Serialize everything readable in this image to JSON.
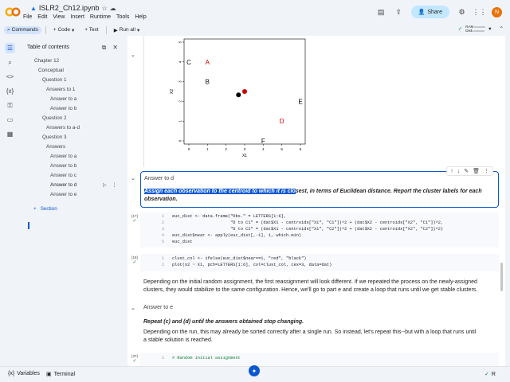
{
  "app": {
    "notebook_name": "ISLR2_Ch12.ipynb",
    "menus": [
      "File",
      "Edit",
      "View",
      "Insert",
      "Runtime",
      "Tools",
      "Help"
    ],
    "share_label": "Share",
    "avatar_initial": "N",
    "brand_color": "#e8710a"
  },
  "toolbar": {
    "commands": "Commands",
    "code": "+ Code",
    "text": "+ Text",
    "run_all": "Run all",
    "ram": "RAM",
    "disk": "Disk"
  },
  "toc": {
    "title": "Table of contents",
    "items": [
      {
        "label": "Chapter 12"
      },
      {
        "label": "Conceptual"
      },
      {
        "label": "Question 1"
      },
      {
        "label": "Answers to 1"
      },
      {
        "label": "Answer to a"
      },
      {
        "label": "Answer to b"
      },
      {
        "label": "Question 2"
      },
      {
        "label": "Answers to a-d"
      },
      {
        "label": "Question 3"
      },
      {
        "label": "Answers"
      },
      {
        "label": "Answer to a"
      },
      {
        "label": "Answer to b"
      },
      {
        "label": "Answer to c"
      },
      {
        "label": "Answer to d"
      },
      {
        "label": "Answer to e"
      }
    ],
    "section_label": "Section"
  },
  "plot": {
    "chart_data": {
      "type": "scatter",
      "xlabel": "X1",
      "ylabel": "X2",
      "xticks": [
        "0",
        "1",
        "2",
        "3",
        "4",
        "5",
        "6"
      ],
      "yticks": [
        "0",
        "1",
        "2",
        "3",
        "4",
        "5"
      ],
      "xlim": [
        0,
        6
      ],
      "ylim": [
        0,
        5
      ],
      "labels": [
        {
          "text": "C",
          "x": 0.0,
          "y": 4.0,
          "color": "#000000"
        },
        {
          "text": "A",
          "x": 1.0,
          "y": 4.0,
          "color": "#cc0000"
        },
        {
          "text": "B",
          "x": 1.0,
          "y": 3.0,
          "color": "#000000"
        },
        {
          "text": "E",
          "x": 6.0,
          "y": 2.0,
          "color": "#000000"
        },
        {
          "text": "D",
          "x": 5.0,
          "y": 1.0,
          "color": "#cc0000"
        },
        {
          "text": "F",
          "x": 4.0,
          "y": 0.0,
          "color": "#000000"
        }
      ],
      "centroids": [
        {
          "x": 3.0,
          "y": 2.5,
          "color": "#cc0000"
        },
        {
          "x": 2.67,
          "y": 2.33,
          "color": "#000000"
        }
      ]
    }
  },
  "answer_d": {
    "title": "Answer to d",
    "body_highlighted": "Assign each observation to the centroid to which it is clo",
    "body_rest": "sest, in terms of Euclidean distance. Report the cluster labels for each observation."
  },
  "cell1": {
    "exec": "[17]",
    "lines": [
      {
        "n": "1",
        "code": "euc_dist <- data.frame(\"Obs.\" = LETTERS[1:6],"
      },
      {
        "n": "2",
        "code": "                       \"D to C1\" = (dat$X1 - centroids[\"X1\", \"C1\"])^2 + (dat$X2 - centroids[\"X2\", \"C1\"])^2,"
      },
      {
        "n": "3",
        "code": "                       \"D to C2\" = (dat$X1 - centroids[\"X1\", \"C2\"])^2 + (dat$X2 - centroids[\"X2\", \"C2\"])^2)"
      },
      {
        "n": "4",
        "code": "euc_dist$near <- apply(euc_dist[,-1], 1, which.min)"
      },
      {
        "n": "5",
        "code": "euc_dist"
      }
    ]
  },
  "cell2": {
    "exec": "[18]",
    "lines": [
      {
        "n": "1",
        "code": "clust_col <- ifelse(euc_dist$near==1, \"red\", \"black\")"
      },
      {
        "n": "2",
        "code": "plot(X2 ~ X1, pch=LETTERS[1:6], col=clust_col, cex=3, data=dat)"
      }
    ]
  },
  "para1": "Depending on the initial random assignment, the first reassignment will look different. If we repeated the process on the newly-assigned clusters, they would stabilize to the same configuration. Hence, we'll go to part e and create a loop that runs until we get stable clusters.",
  "answer_e": {
    "title": "Answer to e",
    "bold": "Repeat (c) and (d) until the answers obtained stop changing.",
    "para": "Depending on the run, this may already be sorted correctly after a single run. So instead, let's repeat this--but with a loop that runs until a stable solution is reached."
  },
  "cell3": {
    "exec": "[37]",
    "line1": {
      "n": "1",
      "code": "# Random initial assignment"
    }
  },
  "status": {
    "variables": "Variables",
    "terminal": "Terminal",
    "kernel": "R"
  }
}
